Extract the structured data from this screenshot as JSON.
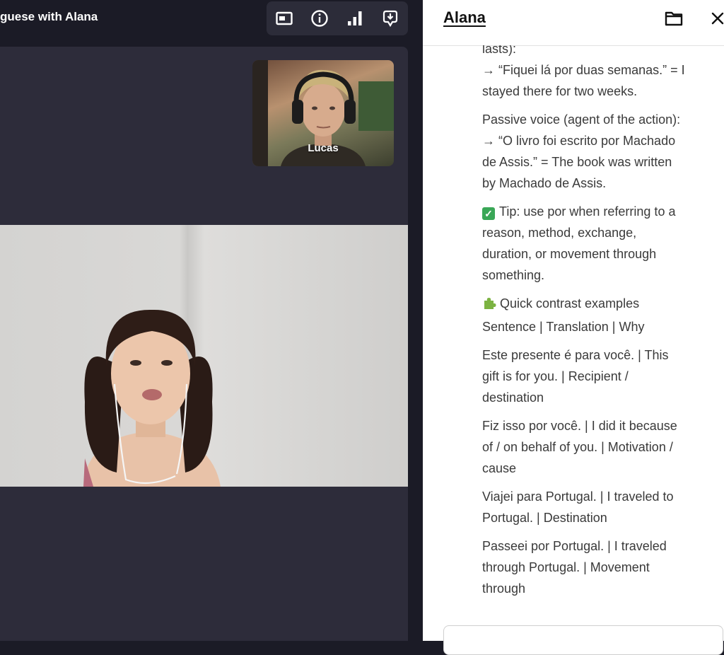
{
  "call": {
    "title": "guese with Alana",
    "toolbar": {
      "layout_icon": "picture-in-picture-icon",
      "info_icon": "info-icon",
      "signal_icon": "signal-bars-icon",
      "record_icon": "download-icon"
    },
    "self_tile": {
      "name": "Lucas"
    },
    "main_participant": "Alana"
  },
  "panel": {
    "title": "Alana",
    "folder_icon": "folder-icon",
    "close_icon": "close-icon",
    "paragraphs": [
      {
        "lines": [
          "lasts):",
          "→ “Fiquei lá por duas semanas.” = I",
          "stayed there for two weeks."
        ]
      },
      {
        "lines": [
          "Passive voice (agent of the action):",
          "→ “O livro foi escrito por Machado",
          "de Assis.” = The book was written",
          "by Machado de Assis."
        ]
      },
      {
        "icon": "check-emoji-icon",
        "lines": [
          "Tip: use por when referring to a",
          "reason, method, exchange,",
          "duration, or movement through",
          "something."
        ]
      },
      {
        "icon": "puzzle-emoji-icon",
        "lines": [
          "Quick contrast examples",
          "Sentence | Translation | Why"
        ]
      },
      {
        "lines": [
          "Este presente é para você. | This",
          "gift is for you. | Recipient /",
          "destination"
        ]
      },
      {
        "lines": [
          "Fiz isso por você. | I did it because",
          "of / on behalf of you. | Motivation /",
          "cause"
        ]
      },
      {
        "lines": [
          "Viajei para Portugal. | I traveled to",
          "Portugal. | Destination"
        ]
      },
      {
        "lines": [
          "Passeei por Portugal. | I traveled",
          "through Portugal. | Movement",
          "through"
        ]
      }
    ]
  },
  "colors": {
    "app_bg": "#1b1b26",
    "stage_bg": "#2d2c3a",
    "toolbar_bg": "#2c2c39",
    "panel_bg": "#ffffff",
    "check_emoji": "#3aa757",
    "puzzle_emoji": "#7cb342"
  }
}
